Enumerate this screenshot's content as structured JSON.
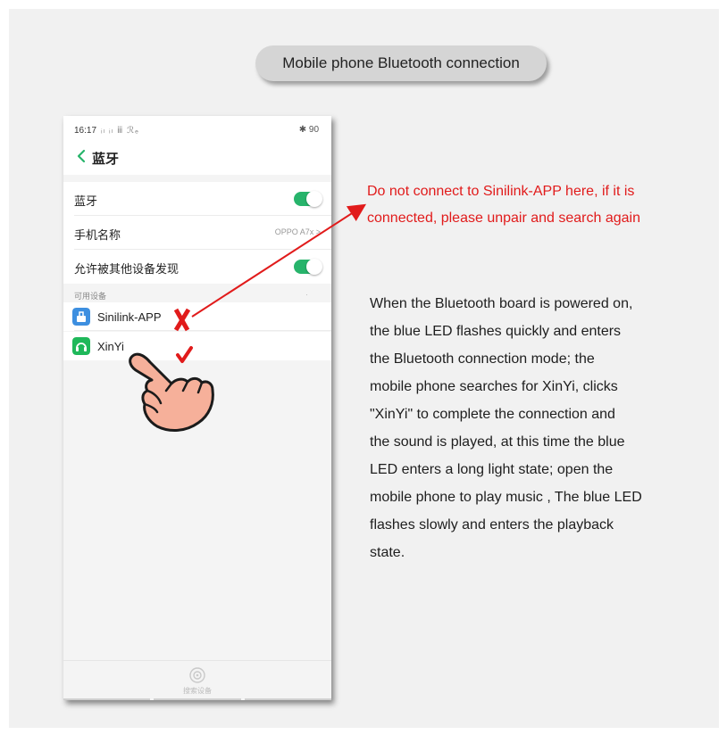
{
  "header": {
    "label": "Mobile phone Bluetooth connection"
  },
  "phone": {
    "status": {
      "time": "16:17",
      "signal": "ᵢₗ ᵢₗ ⅲ ℛₑ",
      "right": "✱ 90"
    },
    "nav": {
      "back_icon": "chevron-left-icon",
      "title": "蓝牙"
    },
    "settings": [
      {
        "label": "蓝牙",
        "control": "toggle-on"
      },
      {
        "label": "手机名称",
        "value": "OPPO A7x >"
      },
      {
        "label": "允许被其他设备发现",
        "control": "toggle-on"
      }
    ],
    "section_header": "可用设备",
    "devices": [
      {
        "name": "Sinilink-APP",
        "icon": "bluetooth-app-icon",
        "icon_color": "#3d8fe0",
        "mark": "X"
      },
      {
        "name": "XinYi",
        "icon": "headset-icon",
        "icon_color": "#1fb85a",
        "mark": "✔"
      }
    ],
    "bottom": {
      "icon": "scan-icon",
      "label": "搜索设备"
    }
  },
  "note": {
    "line1": "Do not connect to Sinilink-APP here, if it is",
    "line2": "connected, please unpair and search again",
    "color": "#e11b1b"
  },
  "description": [
    "When the Bluetooth board is powered on,",
    "the blue LED flashes quickly and enters",
    "the Bluetooth connection mode; the",
    "mobile phone searches for XinYi, clicks",
    "\"XinYi\" to complete the connection and",
    "the sound is played, at this time the blue",
    "LED enters a long light state; open the",
    "mobile phone to play music , The blue LED",
    "flashes slowly and enters the playback",
    "state."
  ],
  "colors": {
    "accent_red": "#e11b1b",
    "toggle_green": "#27b46b",
    "hand_skin": "#f6b09a"
  }
}
